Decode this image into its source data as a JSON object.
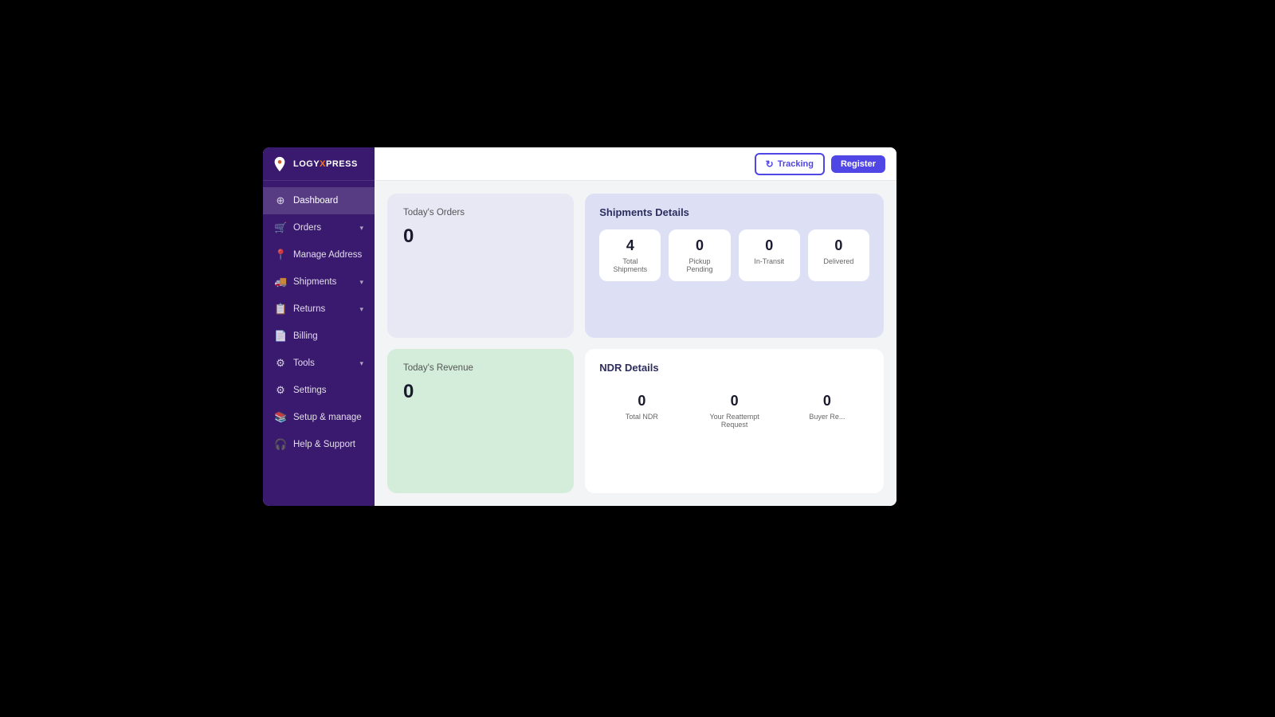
{
  "brand": {
    "name": "LOGY",
    "highlight": "X",
    "suffix": "PRESS"
  },
  "header": {
    "tracking_label": "Tracking",
    "register_label": "Register"
  },
  "sidebar": {
    "items": [
      {
        "id": "dashboard",
        "label": "Dashboard",
        "icon": "⊕",
        "active": true
      },
      {
        "id": "orders",
        "label": "Orders",
        "icon": "🛒",
        "has_chevron": true
      },
      {
        "id": "manage-address",
        "label": "Manage Address",
        "icon": "📍"
      },
      {
        "id": "shipments",
        "label": "Shipments",
        "icon": "🚚",
        "has_chevron": true
      },
      {
        "id": "returns",
        "label": "Returns",
        "icon": "📋",
        "has_chevron": true
      },
      {
        "id": "billing",
        "label": "Billing",
        "icon": "📄"
      },
      {
        "id": "tools",
        "label": "Tools",
        "icon": "⚙",
        "has_chevron": true
      },
      {
        "id": "settings",
        "label": "Settings",
        "icon": "⚙"
      },
      {
        "id": "setup-manage",
        "label": "Setup & manage",
        "icon": "📚"
      },
      {
        "id": "help-support",
        "label": "Help & Support",
        "icon": "🎧"
      }
    ]
  },
  "widgets": {
    "todays_orders": {
      "title": "Today's Orders",
      "value": "0"
    },
    "todays_revenue": {
      "title": "Today's Revenue",
      "value": "0"
    },
    "shipments_details": {
      "title": "Shipments Details",
      "stats": [
        {
          "label": "Total Shipments",
          "value": "4"
        },
        {
          "label": "Pickup Pending",
          "value": "0"
        },
        {
          "label": "In-Transit",
          "value": "0"
        },
        {
          "label": "Delivered",
          "value": "0"
        }
      ]
    },
    "ndr_details": {
      "title": "NDR Details",
      "stats": [
        {
          "label": "Total NDR",
          "value": "0"
        },
        {
          "label": "Your Reattempt Request",
          "value": "0"
        },
        {
          "label": "Buyer Re...",
          "value": "0"
        }
      ]
    }
  }
}
